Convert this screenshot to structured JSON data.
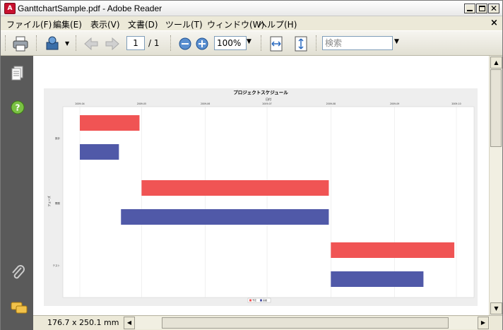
{
  "window": {
    "title": "GanttchartSample.pdf - Adobe Reader",
    "app_icon_glyph": "A"
  },
  "menu": [
    {
      "label": "ファイル(F)"
    },
    {
      "label": "編集(E)"
    },
    {
      "label": "表示(V)"
    },
    {
      "label": "文書(D)"
    },
    {
      "label": "ツール(T)"
    },
    {
      "label": "ウィンドウ(W)"
    },
    {
      "label": "ヘルプ(H)"
    }
  ],
  "menu_close_glyph": "×",
  "toolbar": {
    "page_current": "1",
    "page_total": "/ 1",
    "zoom": "100%",
    "search_placeholder": "検索",
    "icons": [
      "printer-icon",
      "stamp-icon",
      "back-arrow-icon",
      "forward-arrow-icon",
      "zoom-out-icon",
      "zoom-in-icon",
      "fit-width-icon",
      "fit-page-icon"
    ]
  },
  "leftpane": {
    "icons": [
      "pages-icon",
      "help-icon",
      "attachment-icon",
      "comments-icon"
    ]
  },
  "statusbar": {
    "page_size": "176.7 x 250.1 mm"
  },
  "chart_data": {
    "type": "gantt",
    "title": "プロジェクトスケジュール",
    "xlabel": "日付",
    "ylabel": "フェーズ",
    "x_ticks": [
      "2009-04",
      "2009-05",
      "2009-06",
      "2009-07",
      "2009-08",
      "2009-09",
      "2009-10"
    ],
    "x_range": [
      "2009-04-01",
      "2009-10-01"
    ],
    "categories": [
      "設計",
      "開発",
      "テスト"
    ],
    "series": [
      {
        "name": "予定",
        "color": "#f05454",
        "bars": [
          {
            "category": "設計",
            "start": "2009-04-01",
            "end": "2009-04-30"
          },
          {
            "category": "開発",
            "start": "2009-05-01",
            "end": "2009-07-31"
          },
          {
            "category": "テスト",
            "start": "2009-08-01",
            "end": "2009-09-30"
          }
        ]
      },
      {
        "name": "実績",
        "color": "#5059a8",
        "bars": [
          {
            "category": "設計",
            "start": "2009-04-01",
            "end": "2009-04-20"
          },
          {
            "category": "開発",
            "start": "2009-04-21",
            "end": "2009-07-31"
          },
          {
            "category": "テスト",
            "start": "2009-08-01",
            "end": "2009-09-15"
          }
        ]
      }
    ],
    "grid": true,
    "legend_position": "bottom"
  }
}
